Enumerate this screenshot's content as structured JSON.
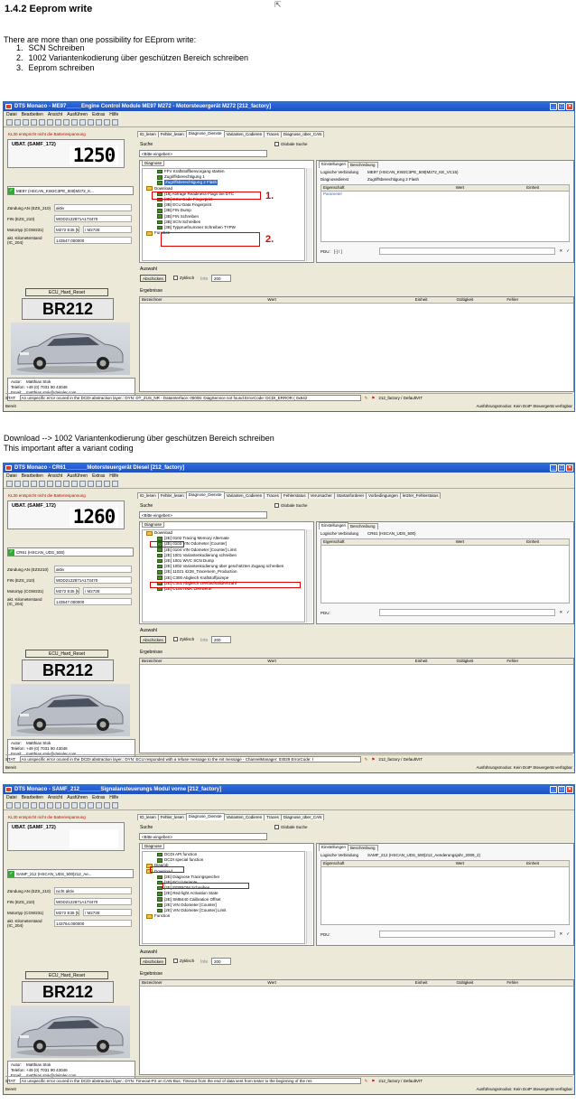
{
  "doc": {
    "heading": "1.4.2 Eeprom write",
    "intro": "There are more than one possibility for EEprom write:",
    "list": [
      {
        "num": "1.",
        "text": "SCN Schreiben"
      },
      {
        "num": "2.",
        "text": "1002 Variantenkodierung über geschützen Bereich schreiben"
      },
      {
        "num": "3.",
        "text": "Eeprom schreiben"
      }
    ],
    "para2_line1": "Download --> 1002 Variantenkodierung über geschützen Bereich schreiben",
    "para2_line2": "This important after a variant coding"
  },
  "common": {
    "menu": [
      "Datei",
      "Bearbeiten",
      "Ansicht",
      "Ausführen",
      "Extras",
      "Hilfe"
    ],
    "warning": "KL30 entspricht nicht die Batteriespannung",
    "ubat_label": "UBAT. (SAMF_172)",
    "search_label": "Suche",
    "search_value": "<Bitte eingeben>",
    "global_search": "Globale Suche",
    "diag_tab": "Diagnose",
    "auswahl": "Auswahl",
    "abschicken": "Abschicken",
    "zyklisch": "Zyklisch",
    "intervall": "Inte",
    "intervall_value": "200",
    "ergebnisse": "Ergebnisse",
    "result_cols": [
      "Bezeichner",
      "Wert",
      "Einheit",
      "Gültigkeit",
      "Fehler"
    ],
    "prop_cols": [
      "Eigenschaft",
      "Wert",
      "Einheit"
    ],
    "rtabs": [
      "Einstellungen",
      "Beschreibung"
    ],
    "logische": "Logische Verbindung",
    "diagnosedienst": "Diagnosedienst",
    "parameter": "Parameter",
    "pdu": "PDU:",
    "ecu_reset": "ECU_Hard_Reset",
    "plate": "BR212",
    "author": [
      {
        "k": "Autor:",
        "v": "Matthias Stok"
      },
      {
        "k": "Telefon:",
        "v": "+49 (0) 7031 90 43046"
      },
      {
        "k": "Email:",
        "v": "matthias.stok@daimler.com"
      }
    ],
    "bereit": "Bereit",
    "bottom_right": "Ausführungsmodus: Kein DoIP Steuergerät verfügbar",
    "status_prefix": "STAT:"
  },
  "windows": [
    {
      "title": "DTS Monaco - ME97_____Engine Control Module ME97 M272 - Motorsteuergerät M272 [212_factory]",
      "tabs": [
        "ID_lesen",
        "Fehler_lesen",
        "Diagnose_Dienste",
        "Varianten_Codieren",
        "Traces",
        "Diagnose_über_CAN"
      ],
      "active_tab": 2,
      "display": "1250",
      "ecu": "ME97 (HSCAN_KW2C3PE_500|M272_K...",
      "info": [
        {
          "k": "Zündung AN (EZS_210)",
          "v": "aktiv"
        },
        {
          "k": "FIN (EZS_210)",
          "v": "WDD2122871A173470"
        },
        {
          "k": "Motortyp (CGW231)",
          "v": "M272 E35 [ME9.7]",
          "v2": "/ M272E"
        },
        {
          "k": "akt. Kilometerstand (IC_204)",
          "v": "143547.000000"
        }
      ],
      "tree": [
        {
          "t": "FFV Kraftstoffbenvorgang starten",
          "kind": "g"
        },
        {
          "t": "Zugriffsberechtigung 1",
          "kind": "g"
        },
        {
          "t": "Zugriffsberechtigung 2 Flash",
          "kind": "g",
          "sel": true
        },
        {
          "t": "Download",
          "kind": "f"
        },
        {
          "t": "[18] Abfrage Readiness-Flags bei DTC",
          "kind": "g"
        },
        {
          "t": "[3B] ECU Code Fingerprint",
          "kind": "g"
        },
        {
          "t": "[3B] ECU Data Fingerprint",
          "kind": "g"
        },
        {
          "t": "[3B] FIN Dump",
          "kind": "g"
        },
        {
          "t": "[3B] FIN Schreiben",
          "kind": "g"
        },
        {
          "t": "[3B] SCN Schreiben",
          "kind": "g"
        },
        {
          "t": "[3B] Typpruefnummer Schreiben TYPW",
          "kind": "g"
        },
        {
          "t": "Function",
          "kind": "f"
        }
      ],
      "log_conn": "ME97 (HSCAN_KW2C3PE_500|M272_KE_VC15)",
      "diag_service": "Zugriffsberechtigung 2 Flash",
      "pdu_val": "[-] / ]",
      "anno": [
        "1.",
        "2."
      ],
      "status": "An unspecific error ocured in the DCDI abstraction layer.: DYN: DT_ZUS_NR - DataInterface: 05006: DiagService not found ErrorCode: DCDI_ERROR  ( 0x842 ",
      "status_right": "212_factory / DefaultVIT"
    },
    {
      "title": "DTS Monaco - CR61_______Motorsteuergerät Diesel [212_factory]",
      "tabs": [
        "ID_lesen",
        "Fehler_lesen",
        "Diagnose_Dienste",
        "Varianten_Codieren",
        "Traces",
        "Fehlerstatus",
        "Verursacher",
        "Startanforderer",
        "Vorbedingungen",
        "letzter_Fehlerstatus"
      ],
      "active_tab": 2,
      "display": "1260",
      "ecu": "CR61 (HSCAN_UDS_500)",
      "info": [
        {
          "k": "Zündung AN (EZS210)",
          "v": "aktiv"
        },
        {
          "k": "FIN (EZS_210)",
          "v": "WDD2122871A173470"
        },
        {
          "k": "Motortyp (CGW231)",
          "v": "M272 E35 [ME9.7]",
          "v2": "/ M272E"
        },
        {
          "k": "akt. Kilometerstand (IC_204)",
          "v": "143547.000000"
        }
      ],
      "tree": [
        {
          "t": "Download",
          "kind": "f"
        },
        {
          "t": "[2E] 0102 Tracing Memory Alternate",
          "kind": "g"
        },
        {
          "t": "[2E] 0103 VIN Odometer [Counter]",
          "kind": "g"
        },
        {
          "t": "[2E] 0104 VIN Odometer [Counter] Limit",
          "kind": "g"
        },
        {
          "t": "[2E] 1001 Variantenkodierung schreiben",
          "kind": "g"
        },
        {
          "t": "[2E] 1001 WVC SCN Dump",
          "kind": "g"
        },
        {
          "t": "[2E] 1002 Variantenkodierung über geschützten Zugang schreiben",
          "kind": "g"
        },
        {
          "t": "[2E] 11021 4228_Tracemem_Production",
          "kind": "g"
        },
        {
          "t": "[2E] C300 Abgleich Kraftstoffpumpe",
          "kind": "g"
        },
        {
          "t": "[2E] C301 Abgleich Leerlaufsolldrehzahl",
          "kind": "g"
        },
        {
          "t": "[2E] C100 NMK Leerwerte",
          "kind": "g"
        }
      ],
      "log_conn": "CR61 (HSCAN_UDS_500)",
      "diag_service": "",
      "pdu_val": "",
      "anno": [],
      "status": "An unspecific error ocured in the DCDI abstraction layer.: DYN: ECU responded with a refuse message to the init message - ChannelManager: 03029 ErrorCode: I",
      "status_right": "212_factory / DefaultVIT"
    },
    {
      "title": "DTS Monaco - SAMF_212_______Signalansteuerungs Modul vorne [212_factory]",
      "tabs": [
        "ID_lesen",
        "Fehler_lesen",
        "Diagnose_Dienste",
        "Varianten_Codieren",
        "Traces",
        "Diagnose_über_CAN"
      ],
      "active_tab": 2,
      "display": "",
      "ecu": "SAMF_212 (HSCAN_UDS_500|212_Ae...",
      "info": [
        {
          "k": "Zündung AN (EZS_210)",
          "v": "nicht aktiv"
        },
        {
          "k": "FIN (EZS_210)",
          "v": "WDD2122871A173470"
        },
        {
          "k": "Motortyp (CGW231)",
          "v": "M272 E35 [ME9.7]",
          "v2": "/ M272E"
        },
        {
          "k": "akt. Kilometerstand (IC_204)",
          "v": "143764.000000"
        }
      ],
      "tree": [
        {
          "t": "DCDI API function",
          "kind": "g"
        },
        {
          "t": "DCDI special function",
          "kind": "g"
        },
        {
          "t": "Diag/ob",
          "kind": "f"
        },
        {
          "t": "Download",
          "kind": "f"
        },
        {
          "t": "[2E] Diagnose Tracingspeicher",
          "kind": "g"
        },
        {
          "t": "[2E] ECU Variante",
          "kind": "g"
        },
        {
          "t": "[2E] EEPROM Schreiben",
          "kind": "g"
        },
        {
          "t": "[2E] Red-light Activation State",
          "kind": "g"
        },
        {
          "t": "[2E] SMB440 Calibration Offset",
          "kind": "g"
        },
        {
          "t": "[2E] VIN Odometer [Counter]",
          "kind": "g"
        },
        {
          "t": "[2E] VIN Odometer [Counter] Limit",
          "kind": "g"
        },
        {
          "t": "Function",
          "kind": "f"
        }
      ],
      "log_conn": "SAMF_212 (HSCAN_UDS_500|212_Aenderungsjahr_2009_2)",
      "diag_service": "",
      "pdu_val": "",
      "anno": [],
      "status": "An unspecific error ocured in the DCDI abstraction layer.: DYN: Timeout-P2 on CAN-Bus: Timeout from the end of data sent from tester to the beginning of the res",
      "status_right": "212_factory / DefaultVIT"
    }
  ],
  "colors": {
    "title_bar": "#1d4fbf",
    "highlight_box": "#dd0000",
    "selection": "#316ac5",
    "warning": "#cc0000"
  }
}
